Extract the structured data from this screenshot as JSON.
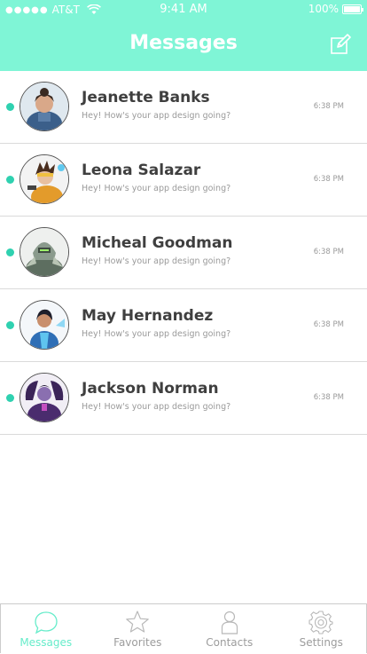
{
  "status_bar": {
    "signal_dots": "●●●●●",
    "carrier": "AT&T",
    "time": "9:41 AM",
    "battery": "100%"
  },
  "header": {
    "title": "Messages",
    "compose_icon": "compose-icon"
  },
  "conversations": [
    {
      "name": "Jeanette Banks",
      "preview": "Hey! How's your app design going?",
      "time": "6:38 PM",
      "unread": true,
      "avatar_color": "#7b4c3a"
    },
    {
      "name": "Leona Salazar",
      "preview": "Hey! How's your app design going?",
      "time": "6:38 PM",
      "unread": true,
      "avatar_color": "#e0a030"
    },
    {
      "name": "Micheal Goodman",
      "preview": "Hey! How's your app design going?",
      "time": "6:38 PM",
      "unread": true,
      "avatar_color": "#6a7f68"
    },
    {
      "name": "May Hernandez",
      "preview": "Hey! How's your app design going?",
      "time": "6:38 PM",
      "unread": true,
      "avatar_color": "#4db6e8"
    },
    {
      "name": "Jackson Norman",
      "preview": "Hey! How's your app design going?",
      "time": "6:38 PM",
      "unread": true,
      "avatar_color": "#6a3fa0"
    }
  ],
  "tabs": [
    {
      "label": "Messages",
      "icon": "chat-bubble-icon",
      "active": true
    },
    {
      "label": "Favorites",
      "icon": "star-icon",
      "active": false
    },
    {
      "label": "Contacts",
      "icon": "person-icon",
      "active": false
    },
    {
      "label": "Settings",
      "icon": "gear-icon",
      "active": false
    }
  ],
  "colors": {
    "accent": "#7ff5d6",
    "unread_dot": "#2fd1b0",
    "active_tab": "#66ecca"
  }
}
